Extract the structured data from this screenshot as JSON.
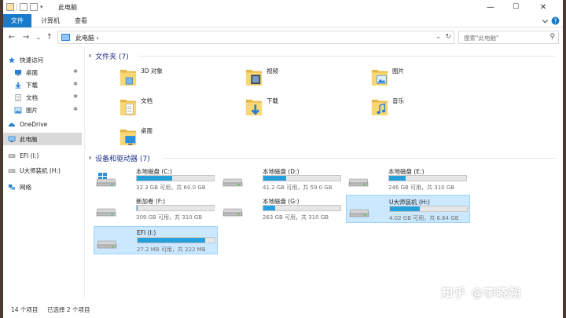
{
  "window": {
    "title": "此电脑",
    "controls": {
      "minimize": "—",
      "maximize": "☐",
      "close": "✕"
    }
  },
  "ribbon": {
    "tabs": [
      "文件",
      "计算机",
      "查看"
    ]
  },
  "nav": {
    "back": "←",
    "forward": "→",
    "recent": "⌄",
    "up": "↑",
    "breadcrumb": "此电脑  ›",
    "search_placeholder": "搜索\"此电脑\""
  },
  "sidebar": {
    "items": [
      {
        "label": "快速访问",
        "icon": "star-icon",
        "pinned": false
      },
      {
        "label": "桌面",
        "icon": "desktop-icon",
        "pinned": true
      },
      {
        "label": "下载",
        "icon": "download-icon",
        "pinned": true
      },
      {
        "label": "文档",
        "icon": "document-icon",
        "pinned": true
      },
      {
        "label": "图片",
        "icon": "picture-icon",
        "pinned": true
      },
      {
        "label": "OneDrive",
        "icon": "cloud-icon",
        "pinned": false
      },
      {
        "label": "此电脑",
        "icon": "computer-icon",
        "pinned": false,
        "selected": true
      },
      {
        "label": "EFI (I:)",
        "icon": "drive-icon",
        "pinned": false
      },
      {
        "label": "U大师装机 (H:)",
        "icon": "drive-icon",
        "pinned": false
      },
      {
        "label": "网络",
        "icon": "network-icon",
        "pinned": false
      }
    ]
  },
  "folders_group": {
    "title": "文件夹 (7)",
    "items": [
      {
        "label": "3D 对象",
        "icon": "3d-objects-folder-icon"
      },
      {
        "label": "视频",
        "icon": "videos-folder-icon"
      },
      {
        "label": "图片",
        "icon": "pictures-folder-icon"
      },
      {
        "label": "文档",
        "icon": "documents-folder-icon"
      },
      {
        "label": "下载",
        "icon": "downloads-folder-icon"
      },
      {
        "label": "音乐",
        "icon": "music-folder-icon"
      },
      {
        "label": "桌面",
        "icon": "desktop-folder-icon"
      }
    ]
  },
  "drives_group": {
    "title": "设备和驱动器 (7)",
    "items": [
      {
        "name": "本地磁盘 (C:)",
        "space": "32.3 GB 可用，共 60.0 GB",
        "used_fraction": 0.46,
        "icon": "windows-drive-icon",
        "selected": false
      },
      {
        "name": "本地磁盘 (D:)",
        "space": "41.2 GB 可用，共 59.0 GB",
        "used_fraction": 0.3,
        "icon": "drive-icon",
        "selected": false
      },
      {
        "name": "本地磁盘 (E:)",
        "space": "246 GB 可用，共 310 GB",
        "used_fraction": 0.21,
        "icon": "drive-icon",
        "selected": false
      },
      {
        "name": "新加卷 (F:)",
        "space": "309 GB 可用，共 310 GB",
        "used_fraction": 0.01,
        "icon": "drive-icon",
        "selected": false
      },
      {
        "name": "本地磁盘 (G:)",
        "space": "263 GB 可用，共 310 GB",
        "used_fraction": 0.15,
        "icon": "drive-icon",
        "selected": false
      },
      {
        "name": "U大师装机 (H:)",
        "space": "4.02 GB 可用，共 6.64 GB",
        "used_fraction": 0.39,
        "icon": "drive-icon",
        "selected": true
      },
      {
        "name": "EFI (I:)",
        "space": "27.2 MB 可用，共 222 MB",
        "used_fraction": 0.88,
        "icon": "drive-icon",
        "selected": true
      }
    ]
  },
  "status": {
    "count": "14 个项目",
    "selected": "已选择 2 个项目"
  },
  "watermark": "知乎 @李晓朔",
  "colors": {
    "accent": "#1979ca",
    "bar_fill": "#26a0da",
    "selection": "#cce8ff",
    "group_title": "#1e3287"
  }
}
